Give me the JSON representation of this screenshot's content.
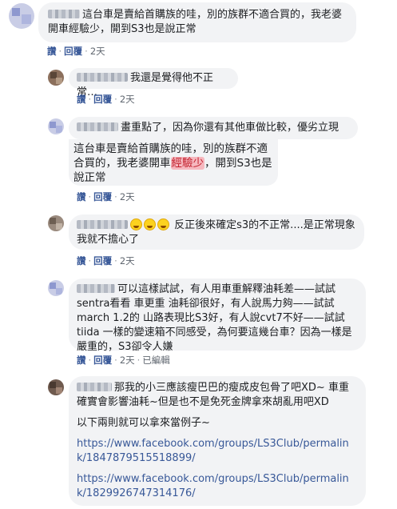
{
  "comments": [
    {
      "text": "這台車是賣給首購族的哇，別的族群不適合買的，我老婆開車經驗少，開到S3也是說正常",
      "actions": {
        "like": "讚",
        "reply": "回覆",
        "time": "2天"
      }
    },
    {
      "text": "我還是覺得他不正常…",
      "actions": {
        "like": "讚",
        "reply": "回覆",
        "time": "2天"
      }
    },
    {
      "text_intro": "畫重點了，因為你還有其他車做比較，優劣立現",
      "quote_a": "這台車是賣給首購族的哇，別的族群不適合買的，我老婆開車",
      "quote_highlight": "經驗少",
      "quote_b": "，開到S3也是說正常",
      "actions": {
        "like": "讚",
        "reply": "回覆",
        "time": "2天"
      }
    },
    {
      "text": "反正後來確定s3的不正常....是正常現象我就不擔心了",
      "emoji_count": 3,
      "actions": {
        "like": "讚",
        "reply": "回覆",
        "time": "2天"
      }
    },
    {
      "text": "可以這樣試試，有人用車重解釋油耗差——試試sentra看看 車更重 油耗卻很好，有人說馬力夠——試試march 1.2的 山路表現比S3好，有人說cvt7不好——試試tiida 一樣的變速箱不同感受，為何要這幾台車？因為一樣是嚴重的，S3卻令人嫌",
      "actions": {
        "like": "讚",
        "reply": "回覆",
        "time": "2天",
        "edited": "已編輯"
      }
    },
    {
      "text": "那我的小三應該瘦巴巴的瘦成皮包骨了吧XD~ 車重確實會影響油耗~但是也不是免死金牌拿來胡亂用吧XD",
      "text2": "以下兩則就可以拿來當例子~",
      "link1": "https://www.facebook.com/groups/LS3Club/permalink/1847879515518899/",
      "link2": "https://www.facebook.com/groups/LS3Club/permalink/1829926747314176/"
    }
  ]
}
